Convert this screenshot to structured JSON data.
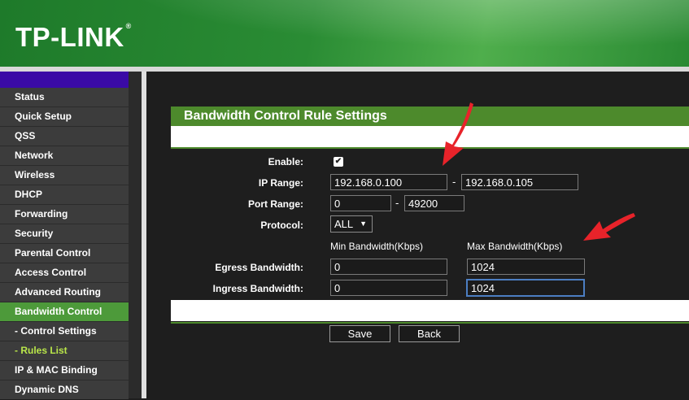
{
  "brand": {
    "logo_text": "TP-LINK",
    "trademark": "®"
  },
  "sidebar": {
    "items": [
      {
        "label": "Status"
      },
      {
        "label": "Quick Setup"
      },
      {
        "label": "QSS"
      },
      {
        "label": "Network"
      },
      {
        "label": "Wireless"
      },
      {
        "label": "DHCP"
      },
      {
        "label": "Forwarding"
      },
      {
        "label": "Security"
      },
      {
        "label": "Parental Control"
      },
      {
        "label": "Access Control"
      },
      {
        "label": "Advanced Routing"
      },
      {
        "label": "Bandwidth Control"
      },
      {
        "label": "- Control Settings"
      },
      {
        "label": "- Rules List"
      },
      {
        "label": "IP & MAC Binding"
      },
      {
        "label": "Dynamic DNS"
      }
    ]
  },
  "form": {
    "title": "Bandwidth Control Rule Settings",
    "enable_label": "Enable:",
    "enable_checked": true,
    "ip_range_label": "IP Range:",
    "ip_start": "192.168.0.100",
    "ip_end": "192.168.0.105",
    "range_sep": "-",
    "port_range_label": "Port Range:",
    "port_start": "0",
    "port_end": "49200",
    "protocol_label": "Protocol:",
    "protocol_value": "ALL",
    "min_bw_header": "Min Bandwidth(Kbps)",
    "max_bw_header": "Max Bandwidth(Kbps)",
    "egress_label": "Egress Bandwidth:",
    "egress_min": "0",
    "egress_max": "1024",
    "ingress_label": "Ingress Bandwidth:",
    "ingress_min": "0",
    "ingress_max": "1024",
    "save_label": "Save",
    "back_label": "Back"
  },
  "colors": {
    "accent_green": "#4d8a2c",
    "active_menu": "#4d9a3a",
    "annotation_arrow": "#e8232a"
  }
}
